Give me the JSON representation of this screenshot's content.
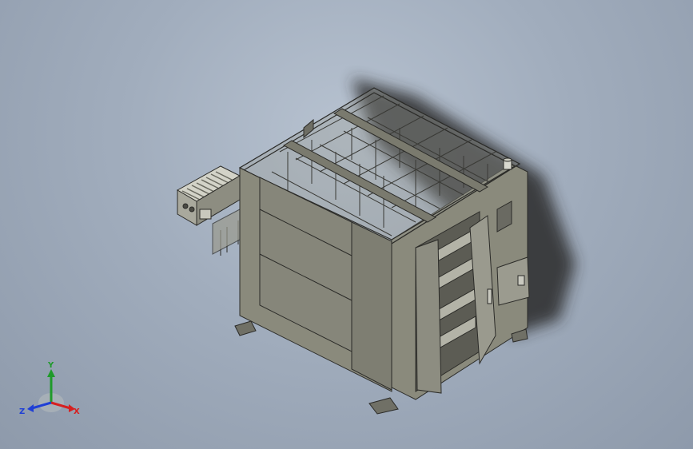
{
  "viewport": {
    "background_top": "#b7c2d0",
    "background_bottom": "#8e9aab"
  },
  "model": {
    "panel_color": "#8a8a7c",
    "panel_dark": "#5f5f55",
    "frame_color": "#b9b9ae",
    "edge_color": "#2b2b28",
    "shadow_color": "#2a2a2a"
  },
  "triad": {
    "x_label": "X",
    "y_label": "Y",
    "z_label": "Z",
    "x_color": "#d62020",
    "y_color": "#1f9a2a",
    "z_color": "#1f3fd6"
  }
}
